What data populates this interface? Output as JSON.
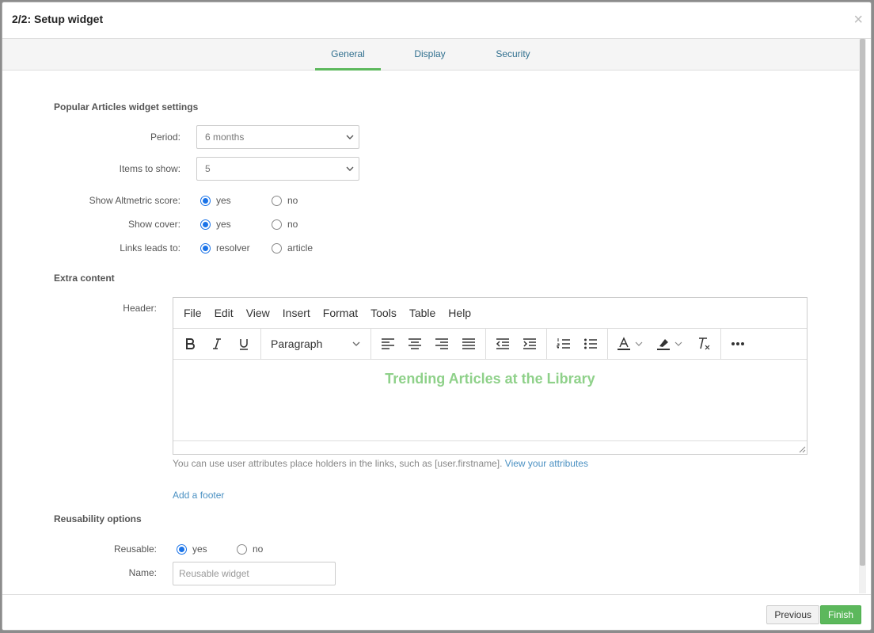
{
  "modal": {
    "title": "2/2: Setup widget",
    "close": "×"
  },
  "tabs": [
    {
      "label": "General",
      "active": true
    },
    {
      "label": "Display",
      "active": false
    },
    {
      "label": "Security",
      "active": false
    }
  ],
  "settings": {
    "title": "Popular Articles widget settings",
    "period": {
      "label": "Period:",
      "value": "6 months"
    },
    "items_to_show": {
      "label": "Items to show:",
      "value": "5"
    },
    "altmetric": {
      "label": "Show Altmetric score:",
      "options": [
        "yes",
        "no"
      ],
      "selected": "yes"
    },
    "cover": {
      "label": "Show cover:",
      "options": [
        "yes",
        "no"
      ],
      "selected": "yes"
    },
    "links": {
      "label": "Links leads to:",
      "options": [
        "resolver",
        "article"
      ],
      "selected": "resolver"
    }
  },
  "extra": {
    "title": "Extra content",
    "header_label": "Header:",
    "menubar": [
      "File",
      "Edit",
      "View",
      "Insert",
      "Format",
      "Tools",
      "Table",
      "Help"
    ],
    "block_format": "Paragraph",
    "content": "Trending Articles at the Library",
    "content_color": "#8fd18a",
    "help_text": "You can use user attributes place holders in the links, such as [user.firstname].",
    "help_link": "View your attributes",
    "add_footer": "Add a footer"
  },
  "reuse": {
    "title": "Reusability options",
    "reusable": {
      "label": "Reusable:",
      "options": [
        "yes",
        "no"
      ],
      "selected": "yes"
    },
    "name": {
      "label": "Name:",
      "placeholder": "Reusable widget"
    }
  },
  "footer": {
    "previous": "Previous",
    "finish": "Finish"
  },
  "colors": {
    "accent": "#5cb85c",
    "link": "#4a90c2",
    "radio": "#1a73e8"
  }
}
